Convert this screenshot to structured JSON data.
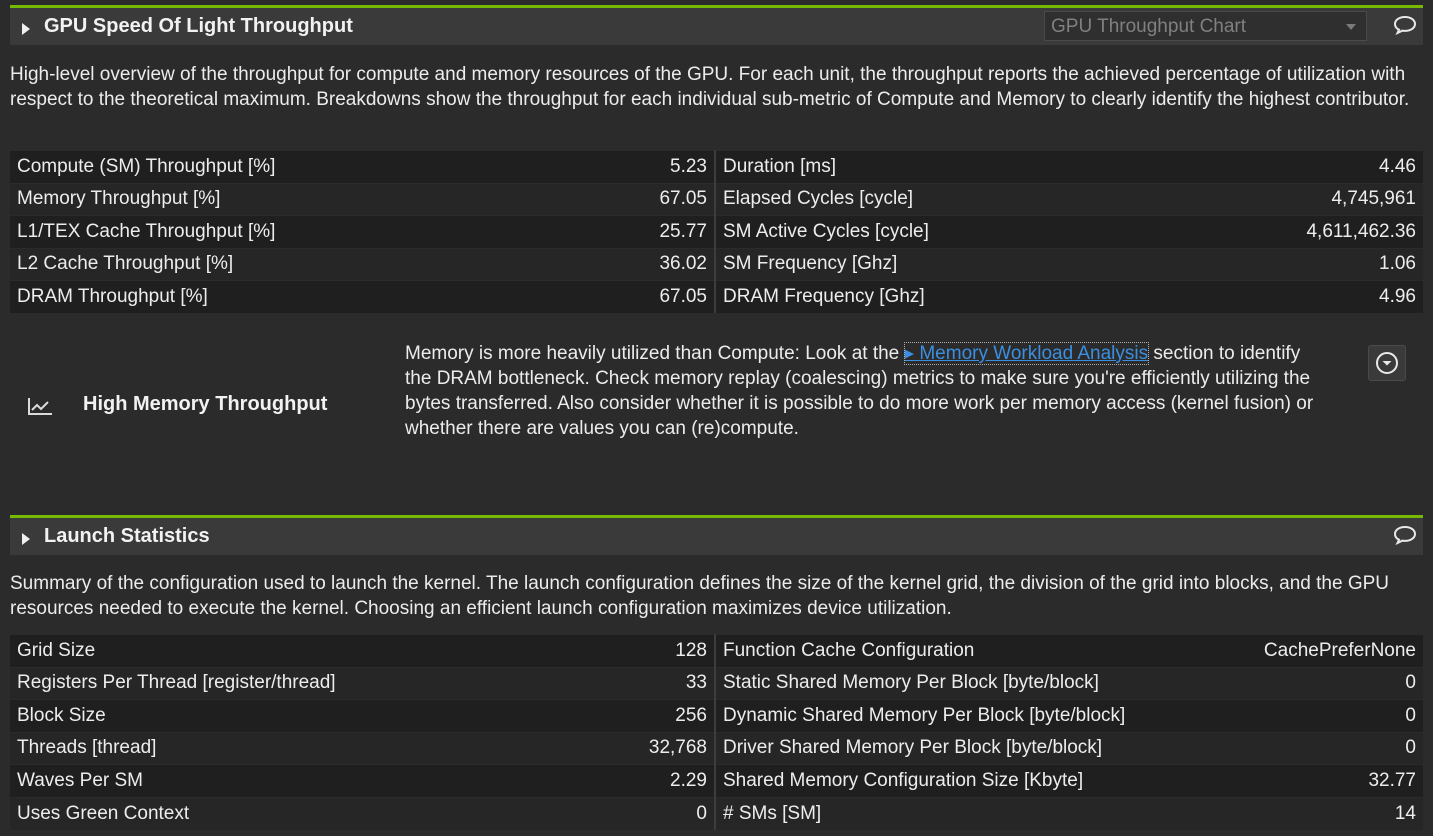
{
  "sol": {
    "title": "GPU Speed Of Light Throughput",
    "chart_select_value": "GPU Throughput Chart",
    "description": "High-level overview of the throughput for compute and memory resources of the GPU. For each unit, the throughput reports the achieved percentage of utilization with respect to the theoretical maximum. Breakdowns show the throughput for each individual sub-metric of Compute and Memory to clearly identify the highest contributor.",
    "rows": [
      {
        "l_name": "Compute (SM) Throughput [%]",
        "l_val": "5.23",
        "r_name": "Duration [ms]",
        "r_val": "4.46"
      },
      {
        "l_name": "Memory Throughput [%]",
        "l_val": "67.05",
        "r_name": "Elapsed Cycles [cycle]",
        "r_val": "4,745,961"
      },
      {
        "l_name": "L1/TEX Cache Throughput [%]",
        "l_val": "25.77",
        "r_name": "SM Active Cycles [cycle]",
        "r_val": "4,611,462.36"
      },
      {
        "l_name": "L2 Cache Throughput [%]",
        "l_val": "36.02",
        "r_name": "SM Frequency [Ghz]",
        "r_val": "1.06"
      },
      {
        "l_name": "DRAM Throughput [%]",
        "l_val": "67.05",
        "r_name": "DRAM Frequency [Ghz]",
        "r_val": "4.96"
      }
    ],
    "rule": {
      "icon": "line-chart-icon",
      "title": "High Memory Throughput",
      "text_before": "Memory is more heavily utilized than Compute: Look at the ",
      "link": "Memory Workload Analysis",
      "text_after": " section to identify the DRAM bottleneck. Check memory replay (coalescing) metrics to make sure you're efficiently utilizing the bytes transferred. Also consider whether it is possible to do more work per memory access (kernel fusion) or whether there are values you can (re)compute."
    }
  },
  "launch": {
    "title": "Launch Statistics",
    "description": "Summary of the configuration used to launch the kernel. The launch configuration defines the size of the kernel grid, the division of the grid into blocks, and the GPU resources needed to execute the kernel. Choosing an efficient launch configuration maximizes device utilization.",
    "rows": [
      {
        "l_name": "Grid Size",
        "l_val": "128",
        "r_name": "Function Cache Configuration",
        "r_val": "CachePreferNone"
      },
      {
        "l_name": "Registers Per Thread [register/thread]",
        "l_val": "33",
        "r_name": "Static Shared Memory Per Block [byte/block]",
        "r_val": "0"
      },
      {
        "l_name": "Block Size",
        "l_val": "256",
        "r_name": "Dynamic Shared Memory Per Block [byte/block]",
        "r_val": "0"
      },
      {
        "l_name": "Threads [thread]",
        "l_val": "32,768",
        "r_name": "Driver Shared Memory Per Block [byte/block]",
        "r_val": "0"
      },
      {
        "l_name": "Waves Per SM",
        "l_val": "2.29",
        "r_name": "Shared Memory Configuration Size [Kbyte]",
        "r_val": "32.77"
      },
      {
        "l_name": "Uses Green Context",
        "l_val": "0",
        "r_name": "# SMs [SM]",
        "r_val": "14"
      }
    ]
  },
  "colors": {
    "accent": "#76b900",
    "link": "#3b8fe0",
    "background": "#2b2b2b"
  }
}
